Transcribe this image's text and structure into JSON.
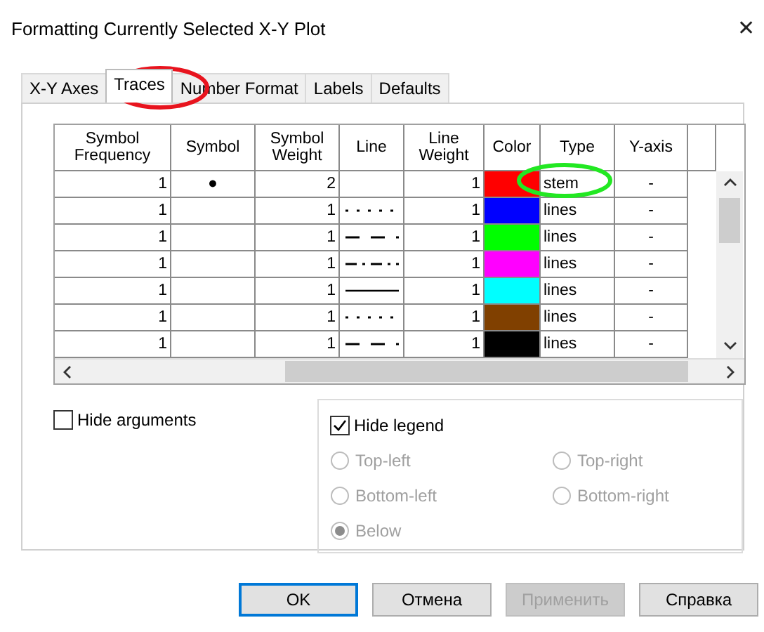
{
  "window": {
    "title": "Formatting Currently Selected X-Y Plot",
    "close": "✕"
  },
  "tabs": [
    {
      "label": "X-Y Axes",
      "selected": false
    },
    {
      "label": "Traces",
      "selected": true
    },
    {
      "label": "Number Format",
      "selected": false
    },
    {
      "label": "Labels",
      "selected": false
    },
    {
      "label": "Defaults",
      "selected": false
    }
  ],
  "table": {
    "columns": [
      "Symbol Frequency",
      "Symbol",
      "Symbol Weight",
      "Line",
      "Line Weight",
      "Color",
      "Type",
      "Y-axis"
    ],
    "rows": [
      {
        "symbol_frequency": "1",
        "symbol": "●",
        "symbol_weight": "2",
        "kind": "none",
        "line_weight": "1",
        "color": "#ff0000",
        "type": "stem",
        "y_axis": "-"
      },
      {
        "symbol_frequency": "1",
        "symbol_weight": "1",
        "kind": "dotted",
        "line_weight": "1",
        "color": "#0000ff",
        "type": "lines",
        "y_axis": "-"
      },
      {
        "symbol_frequency": "1",
        "symbol_weight": "1",
        "kind": "dashed",
        "line_weight": "1",
        "color": "#00ff00",
        "type": "lines",
        "y_axis": "-"
      },
      {
        "symbol_frequency": "1",
        "symbol_weight": "1",
        "kind": "dashdot",
        "line_weight": "1",
        "color": "#ff00ff",
        "type": "lines",
        "y_axis": "-"
      },
      {
        "symbol_frequency": "1",
        "symbol_weight": "1",
        "kind": "solid",
        "line_weight": "1",
        "color": "#00ffff",
        "type": "lines",
        "y_axis": "-"
      },
      {
        "symbol_frequency": "1",
        "symbol_weight": "1",
        "kind": "dotted",
        "line_weight": "1",
        "color": "#804000",
        "type": "lines",
        "y_axis": "-"
      },
      {
        "symbol_frequency": "1",
        "symbol_weight": "1",
        "kind": "dashed",
        "line_weight": "1",
        "color": "#000000",
        "type": "lines",
        "y_axis": "-"
      }
    ]
  },
  "hide_arguments": {
    "label": "Hide arguments",
    "checked": false
  },
  "legend": {
    "hide": {
      "label": "Hide legend",
      "checked": true
    },
    "positions": [
      {
        "label": "Top-left",
        "selected": false,
        "disabled": true
      },
      {
        "label": "Top-right",
        "selected": false,
        "disabled": true
      },
      {
        "label": "Bottom-left",
        "selected": false,
        "disabled": true
      },
      {
        "label": "Bottom-right",
        "selected": false,
        "disabled": true
      },
      {
        "label": "Below",
        "selected": true,
        "disabled": true
      }
    ]
  },
  "buttons": [
    {
      "label": "OK",
      "default": true,
      "disabled": false
    },
    {
      "label": "Отмена",
      "default": false,
      "disabled": false
    },
    {
      "label": "Применить",
      "default": false,
      "disabled": true
    },
    {
      "label": "Справка",
      "default": false,
      "disabled": false
    }
  ],
  "annotations": [
    {
      "color": "#e8141e"
    },
    {
      "color": "#22e822"
    }
  ]
}
